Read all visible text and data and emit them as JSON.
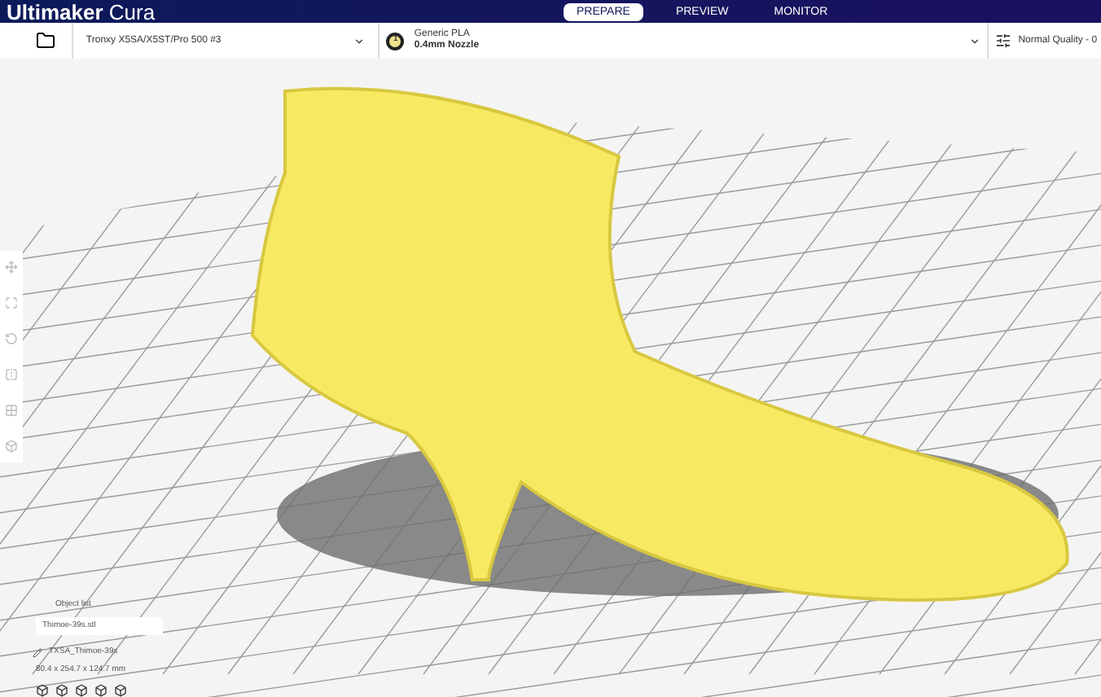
{
  "app": {
    "title_bold": "Ultimaker",
    "title_light": "Cura"
  },
  "stages": [
    {
      "label": "PREPARE",
      "selected": true
    },
    {
      "label": "PREVIEW",
      "selected": false
    },
    {
      "label": "MONITOR",
      "selected": false
    }
  ],
  "printer": {
    "name": "Tronxy X5SA/X5ST/Pro 500 #3"
  },
  "material": {
    "badge": "1",
    "name": "Generic PLA",
    "nozzle": "0.4mm Nozzle"
  },
  "profile": {
    "label": "Normal Quality - 0"
  },
  "object_panel": {
    "heading": "Object list",
    "file": "Thimoe-39s.stl",
    "job_name": "TXSA_Thimoe-39s",
    "dimensions": "80.4 x 254.7 x 124.7 mm"
  }
}
